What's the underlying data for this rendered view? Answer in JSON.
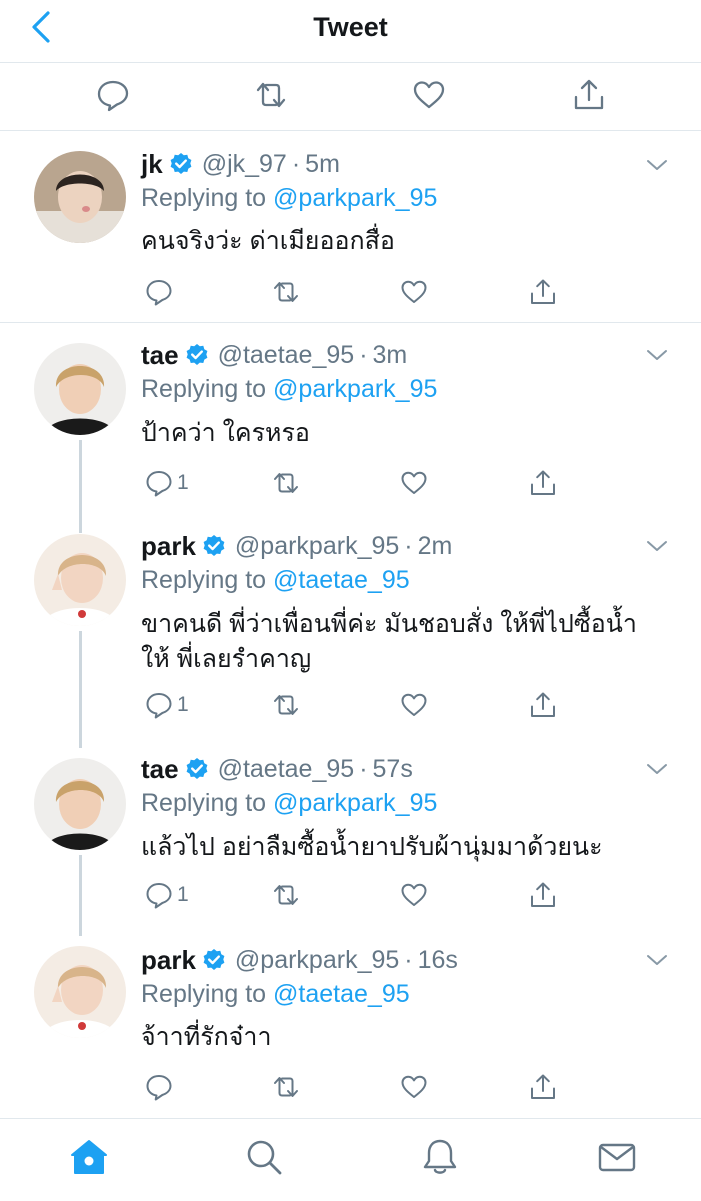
{
  "header": {
    "title": "Tweet"
  },
  "colors": {
    "accent": "#1da1f2",
    "text": "#14171a",
    "muted": "#657786",
    "divider": "#e1e8ed"
  },
  "toolbar": {
    "icons": [
      "reply-icon",
      "retweet-icon",
      "like-icon",
      "share-icon"
    ]
  },
  "tweets": [
    {
      "name": "jk",
      "handle": "@jk_97",
      "time": "5m",
      "reply_prefix": "Replying to",
      "reply_to": "@parkpark_95",
      "text": "คนจริงว่ะ ด่าเมียออกสื่อ",
      "reply_count": ""
    },
    {
      "name": "tae",
      "handle": "@taetae_95",
      "time": "3m",
      "reply_prefix": "Replying to",
      "reply_to": "@parkpark_95",
      "text": "ป้าคว่า ใครหรอ",
      "reply_count": "1"
    },
    {
      "name": "park",
      "handle": "@parkpark_95",
      "time": "2m",
      "reply_prefix": "Replying to",
      "reply_to": "@taetae_95",
      "text_line1": "ขาคนดี พี่ว่าเพื่อนพี่ค่ะ มันชอบสั่ง ให้พี่ไปซื้อน้ำ",
      "text_line2": "ให้ พี่เลยรำคาญ",
      "reply_count": "1"
    },
    {
      "name": "tae",
      "handle": "@taetae_95",
      "time": "57s",
      "reply_prefix": "Replying to",
      "reply_to": "@parkpark_95",
      "text": "แล้วไป อย่าลืมซื้อน้ำยาปรับผ้านุ่มมาด้วยนะ",
      "reply_count": "1"
    },
    {
      "name": "park",
      "handle": "@parkpark_95",
      "time": "16s",
      "reply_prefix": "Replying to",
      "reply_to": "@taetae_95",
      "text": "จ้าาที่รักจ๋าา",
      "reply_count": ""
    }
  ],
  "dot": "·",
  "tabbar": {
    "icons": [
      "home-icon",
      "search-icon",
      "notifications-icon",
      "messages-icon"
    ]
  }
}
